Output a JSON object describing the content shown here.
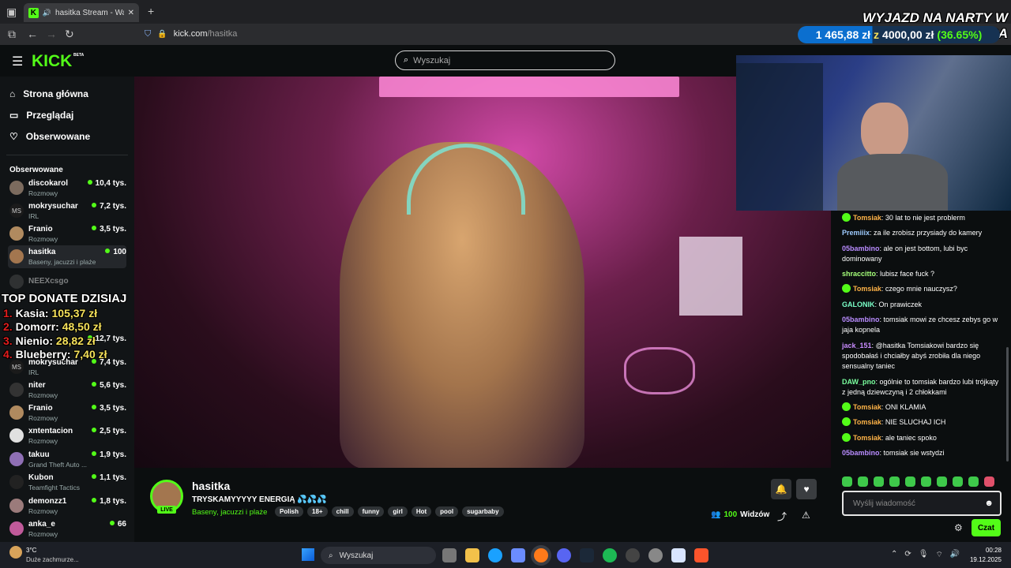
{
  "browser": {
    "tab_title": "hasitka Stream - Watch Live",
    "url_host": "kick.com",
    "url_path": "/hasitka"
  },
  "kick": {
    "logo": "KICK",
    "logo_beta": "BETA",
    "search_placeholder": "Wyszukaj"
  },
  "sidebar": {
    "nav": [
      {
        "label": "Strona główna",
        "icon": "home-icon"
      },
      {
        "label": "Przeglądaj",
        "icon": "browse-icon"
      },
      {
        "label": "Obserwowane",
        "icon": "heart-icon"
      }
    ],
    "section_title": "Obserwowane",
    "channels": [
      {
        "name": "discokarol",
        "category": "Rozmowy",
        "viewers": "10,4 tys."
      },
      {
        "name": "mokrysuchar",
        "category": "IRL",
        "viewers": "7,2 tys."
      },
      {
        "name": "Franio",
        "category": "Rozmowy",
        "viewers": "3,5 tys."
      },
      {
        "name": "hasitka",
        "category": "Baseny, jacuzzi i plaże",
        "viewers": "100"
      },
      {
        "name": "NEEXcsgo",
        "category": "",
        "viewers": ""
      },
      {
        "name": "",
        "category": "",
        "viewers": "12,7 tys."
      },
      {
        "name": "mokrysuchar",
        "category": "IRL",
        "viewers": "7,4 tys."
      },
      {
        "name": "niter",
        "category": "Rozmowy",
        "viewers": "5,6 tys."
      },
      {
        "name": "Franio",
        "category": "Rozmowy",
        "viewers": "3,5 tys."
      },
      {
        "name": "xntentacion",
        "category": "Rozmowy",
        "viewers": "2,5 tys."
      },
      {
        "name": "takuu",
        "category": "Grand Theft Auto ...",
        "viewers": "1,9 tys."
      },
      {
        "name": "Kubon",
        "category": "Teamfight Tactics",
        "viewers": "1,1 tys."
      },
      {
        "name": "demonzz1",
        "category": "Rozmowy",
        "viewers": "1,8 tys."
      },
      {
        "name": "anka_e",
        "category": "Rozmowy",
        "viewers": "66"
      }
    ]
  },
  "donate_overlay": {
    "title": "TOP DONATE DZISIAJ",
    "entries": [
      {
        "rank": "1.",
        "name": "Kasia:",
        "amount": "105,37 zł"
      },
      {
        "rank": "2.",
        "name": "Domorr:",
        "amount": "48,50 zł"
      },
      {
        "rank": "3.",
        "name": "Nienio:",
        "amount": "28,82 zł"
      },
      {
        "rank": "4.",
        "name": "Blueberry:",
        "amount": "7,40 zł"
      }
    ]
  },
  "goal_overlay": {
    "title": "WYJAZD NA NARTY W SYLWESTRA",
    "current": "1 465,88 zł",
    "separator": "z",
    "target": "4000,00 zł",
    "percent": "(36.65%)",
    "progress": 0.3665
  },
  "stream": {
    "streamer": "hasitka",
    "live_label": "LIVE",
    "title": "TRYSKAMYYYYY ENERGIĄ 💦💦💦",
    "category": "Baseny, jacuzzi i plaże",
    "tags": [
      "Polish",
      "18+",
      "chill",
      "funny",
      "girl",
      "Hot",
      "pool",
      "sugarbaby"
    ],
    "viewers": "100",
    "viewers_label": "Widzów"
  },
  "chat": {
    "messages": [
      {
        "user": "Tomsiak",
        "color": "#ffb347",
        "badge": true,
        "text": "30 lat to nie jest problerm"
      },
      {
        "user": "Premiiix",
        "color": "#9ecbff",
        "badge": false,
        "text": "za ile zrobisz przysiady do kamery"
      },
      {
        "user": "05bambino",
        "color": "#b98cff",
        "badge": false,
        "text": "ale on jest bottom, lubi byc dominowany"
      },
      {
        "user": "shraccitto",
        "color": "#a6ff7a",
        "badge": false,
        "text": "lubisz face fuck ?"
      },
      {
        "user": "Tomsiak",
        "color": "#ffb347",
        "badge": true,
        "text": "czego mnie nauczysz?"
      },
      {
        "user": "GALONIK",
        "color": "#7affc8",
        "badge": false,
        "text": "On prawiczek"
      },
      {
        "user": "05bambino",
        "color": "#b98cff",
        "badge": false,
        "text": "tomsiak mowi ze chcesz zebys go w jaja kopnela"
      },
      {
        "user": "jack_151",
        "color": "#c98cff",
        "badge": false,
        "text": "@hasitka Tomsiakowi bardzo się spodobałaś i chciałby abyś zrobiła dla niego sensualny taniec"
      },
      {
        "user": "DAW_pno",
        "color": "#7aff9e",
        "badge": false,
        "text": "ogólnie to tomsiak bardzo lubi trójkąty z jedną dziewczyną i 2 chłokkami"
      },
      {
        "user": "Tomsiak",
        "color": "#ffb347",
        "badge": true,
        "text": "ONI KLAMIA"
      },
      {
        "user": "Tomsiak",
        "color": "#ffb347",
        "badge": true,
        "text": "NIE SLUCHAJ ICH"
      },
      {
        "user": "Tomsiak",
        "color": "#ffb347",
        "badge": true,
        "text": "ale taniec spoko"
      },
      {
        "user": "05bambino",
        "color": "#b98cff",
        "badge": false,
        "text": "tomsiak sie wstydzi"
      }
    ],
    "input_placeholder": "Wyślij wiadomość",
    "send_label": "Czat"
  },
  "taskbar": {
    "weather_temp": "3°C",
    "weather_desc": "Duże zachmurze...",
    "search_label": "Wyszukaj",
    "time": "00:28",
    "date": "19.12.2025"
  },
  "colors": {
    "kick_green": "#53fc18",
    "background": "#0b0e0f"
  }
}
